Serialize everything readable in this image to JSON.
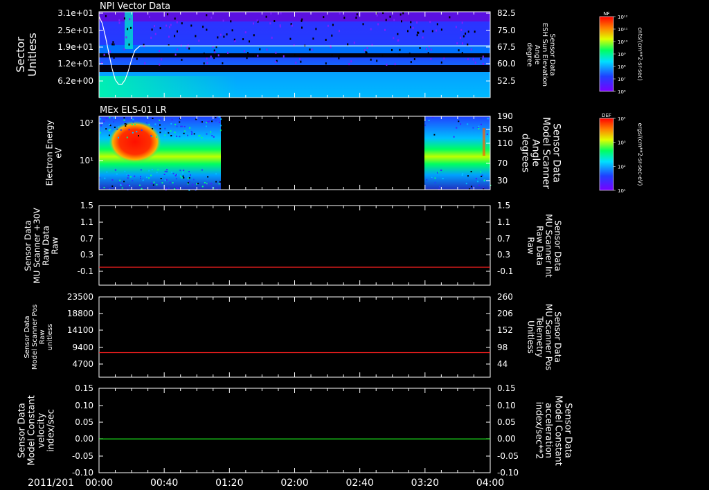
{
  "colors": {
    "background": "#000000",
    "axis": "#ffffff",
    "red_trace": "#ff2020",
    "green_trace": "#20ff20"
  },
  "time_axis": {
    "date": "2011/201",
    "ticks": [
      "00:00",
      "00:40",
      "01:20",
      "02:00",
      "02:40",
      "03:20",
      "04:00"
    ]
  },
  "chart_data": [
    {
      "type": "heatmap",
      "title": "NPI Vector Data",
      "ylabel": [
        "Sector",
        "Unitless"
      ],
      "yticks": [
        "3.1e+01",
        "2.5e+01",
        "1.9e+01",
        "1.2e+01",
        "6.2e+00"
      ],
      "right_label": [
        "Sensor Data",
        "ESH Sun Elevation",
        "Angle",
        "degree"
      ],
      "right_ticks": [
        "82.5",
        "75.0",
        "67.5",
        "60.0",
        "52.5"
      ],
      "overlay_line": {
        "x_min": [
          0,
          2,
          4,
          6,
          8,
          10,
          12,
          14,
          16,
          18,
          20,
          22,
          25,
          30,
          40,
          60,
          120,
          240
        ],
        "y_deg": [
          81,
          78,
          72,
          65,
          58,
          53,
          51,
          51,
          53,
          57,
          62,
          66,
          68,
          68,
          68,
          68,
          68,
          68
        ]
      },
      "colorbar": {
        "label": "NF",
        "units": "cnts/(cm**2-sr-sec)",
        "ticks": [
          "10¹²",
          "10¹¹",
          "10¹⁰",
          "10⁹",
          "10⁸",
          "10⁷",
          "10⁶"
        ]
      }
    },
    {
      "type": "heatmap",
      "title": "MEx ELS-01 LR",
      "ylabel": [
        "Electron Energy",
        "eV"
      ],
      "yticks": [
        "10²",
        "10¹"
      ],
      "right_label": [
        "Sensor Data",
        "Model Scanner",
        "Angle",
        "degrees"
      ],
      "right_ticks": [
        "190",
        "150",
        "110",
        "70",
        "30"
      ],
      "data_gap_min": [
        78,
        201
      ],
      "colorbar": {
        "label": "DEF",
        "units": "ergs/(cm**2-sr-sec-eV)",
        "ticks": [
          "10⁴",
          "10³",
          "10²",
          "10¹"
        ]
      }
    },
    {
      "type": "line",
      "ylabel": [
        "Sensor Data",
        "MU Scanner +30V",
        "Raw Data",
        "Raw"
      ],
      "yticks": [
        "1.5",
        "1.1",
        "0.7",
        "0.3",
        "-0.1"
      ],
      "ylim": [
        -0.3,
        1.5
      ],
      "right_label": [
        "Sensor Data",
        "MU Scanner Int",
        "Raw Data",
        "Raw"
      ],
      "right_ticks": [
        "1.5",
        "1.1",
        "0.7",
        "0.3",
        "-0.1"
      ],
      "series": [
        {
          "values": [
            0,
            0
          ],
          "x_min": [
            0,
            240
          ]
        }
      ]
    },
    {
      "type": "line",
      "ylabel": [
        "Sensor Data",
        "Model Scanner Pos",
        "Raw",
        "unitless"
      ],
      "yticks": [
        "23500",
        "18800",
        "14100",
        "9400",
        "4700"
      ],
      "right_label": [
        "Sensor Data",
        "MU Scanner Pos",
        "Telemetry",
        "Unitless"
      ],
      "right_ticks": [
        "260",
        "206",
        "152",
        "98",
        "44"
      ],
      "series": [
        {
          "values": [
            7900,
            7900
          ],
          "x_min": [
            0,
            240
          ]
        }
      ]
    },
    {
      "type": "line",
      "ylabel": [
        "Sensor Data",
        "Model Constant",
        "velocity",
        "index/sec"
      ],
      "yticks": [
        "0.15",
        "0.10",
        "0.05",
        "0.00",
        "-0.05",
        "-0.10"
      ],
      "ylim": [
        -0.1,
        0.15
      ],
      "right_label": [
        "Sensor Data",
        "Model Constant",
        "acceleration",
        "index/sec**2"
      ],
      "right_ticks": [
        "0.15",
        "0.10",
        "0.05",
        "0.00",
        "-0.05",
        "-0.10"
      ],
      "series": [
        {
          "values": [
            0,
            0
          ],
          "x_min": [
            0,
            240
          ]
        }
      ]
    }
  ]
}
